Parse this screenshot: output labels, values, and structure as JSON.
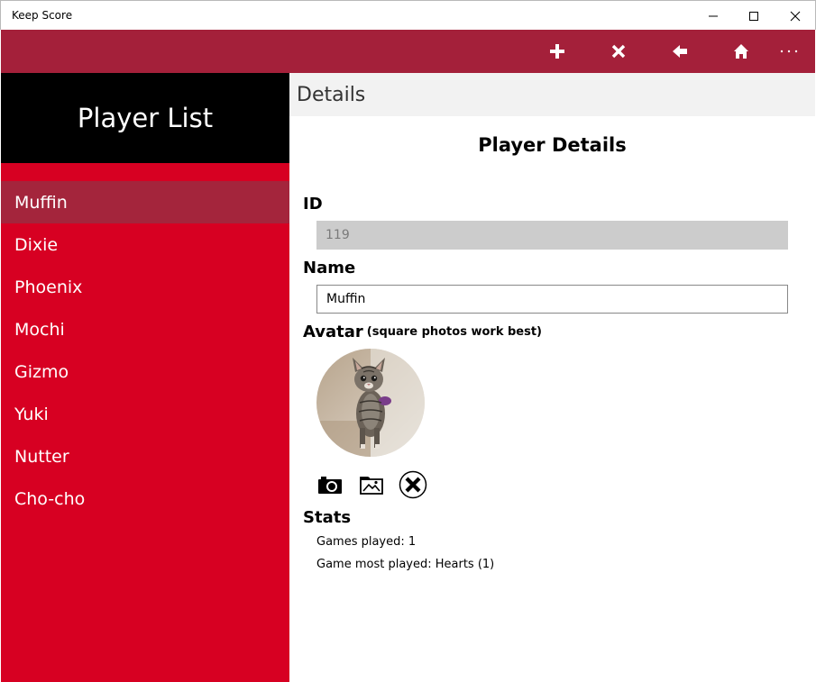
{
  "window": {
    "title": "Keep Score",
    "minimize_icon": "minimize-icon",
    "maximize_icon": "maximize-icon",
    "close_icon": "close-icon"
  },
  "command_bar": {
    "background": "#a4203a",
    "buttons": [
      {
        "name": "add",
        "icon": "plus-icon"
      },
      {
        "name": "delete",
        "icon": "x-icon"
      },
      {
        "name": "back",
        "icon": "arrow-left-icon"
      },
      {
        "name": "home",
        "icon": "home-icon"
      },
      {
        "name": "more",
        "icon": "more-icon",
        "label": "···"
      }
    ]
  },
  "left_pane": {
    "header": "Player List",
    "accent": "#d70022",
    "players": [
      "Muffin",
      "Dixie",
      "Phoenix",
      "Mochi",
      "Gizmo",
      "Yuki",
      "Nutter",
      "Cho-cho"
    ],
    "selected_index": 0
  },
  "details": {
    "header": "Details",
    "title": "Player Details",
    "id_label": "ID",
    "id_value": "119",
    "name_label": "Name",
    "name_value": "Muffin",
    "avatar_label": "Avatar",
    "avatar_hint": "(square photos work best)",
    "avatar_buttons": [
      {
        "name": "take-photo",
        "icon": "camera-icon"
      },
      {
        "name": "choose-photo",
        "icon": "picture-folder-icon"
      },
      {
        "name": "remove-photo",
        "icon": "remove-circle-icon"
      }
    ],
    "stats_label": "Stats",
    "stats": [
      "Games played: 1",
      "Game most played: Hearts (1)"
    ]
  }
}
